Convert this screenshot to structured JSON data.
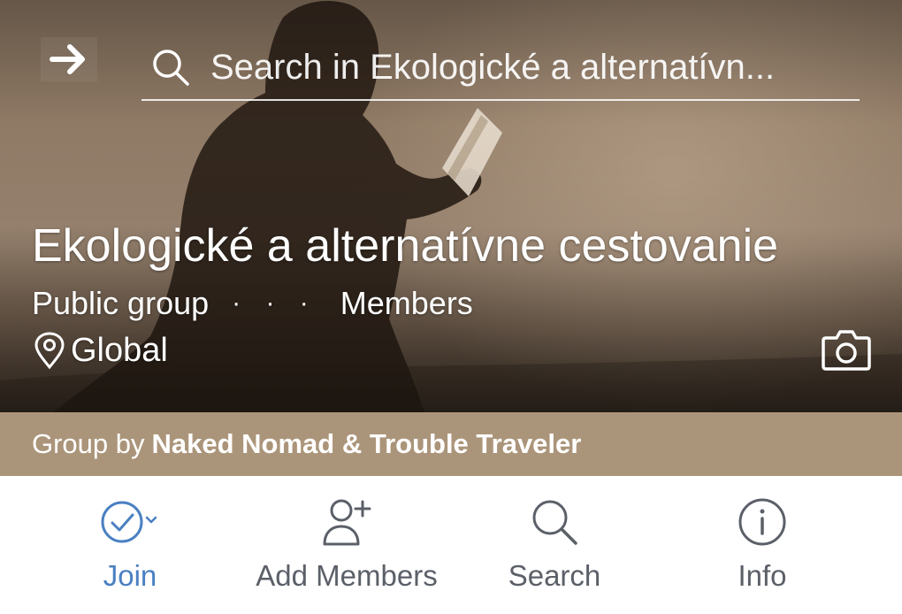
{
  "colors": {
    "accent": "#4a80c2",
    "byline_bg": "#ab957a",
    "icon_gray": "#5b6068",
    "white": "#ffffff"
  },
  "header": {
    "back_icon": "arrow-right-icon",
    "search_icon": "search-icon",
    "search_placeholder": "Search in Ekologické a alternatívn..."
  },
  "group": {
    "title": "Ekologické a alternatívne cestovanie",
    "privacy": "Public group",
    "separator": "· · ·",
    "members_label": "Members",
    "location_icon": "map-pin-icon",
    "location": "Global",
    "camera_icon": "camera-icon"
  },
  "byline": {
    "prefix": "Group by",
    "names": "Naked Nomad & Trouble Traveler"
  },
  "actions": [
    {
      "label": "Join",
      "icon": "check-circle-icon"
    },
    {
      "label": "Add Members",
      "icon": "add-person-icon"
    },
    {
      "label": "Search",
      "icon": "search-icon"
    },
    {
      "label": "Info",
      "icon": "info-icon"
    }
  ]
}
